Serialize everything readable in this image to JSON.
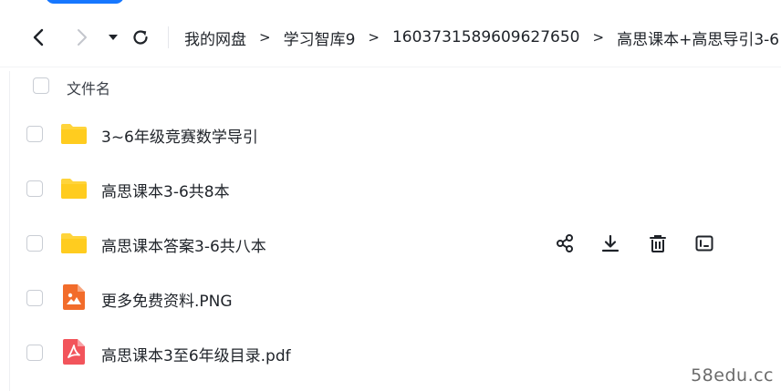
{
  "nav": {
    "back_icon": "chevron-left-icon",
    "forward_icon": "chevron-right-icon",
    "dropdown_icon": "caret-down-icon",
    "refresh_icon": "refresh-icon"
  },
  "breadcrumb": [
    {
      "label": "我的网盘"
    },
    {
      "label": "学习智库9"
    },
    {
      "label": "1603731589609627650"
    },
    {
      "label": "高思课本+高思导引3-6"
    }
  ],
  "header": {
    "column_name": "文件名"
  },
  "files": [
    {
      "name": "3~6年级竞赛数学导引",
      "type": "folder"
    },
    {
      "name": "高思课本3-6共8本",
      "type": "folder"
    },
    {
      "name": "高思课本答案3-6共八本",
      "type": "folder",
      "hovered": true
    },
    {
      "name": "更多免费资料.PNG",
      "type": "image"
    },
    {
      "name": "高思课本3至6年级目录.pdf",
      "type": "pdf"
    }
  ],
  "row_actions": [
    "share-icon",
    "download-icon",
    "delete-icon",
    "rename-icon"
  ],
  "watermark": "58edu.cc",
  "colors": {
    "folder": "#ffd43b",
    "image": "#f26c2b",
    "pdf": "#f2545b",
    "accent": "#1677ff"
  }
}
